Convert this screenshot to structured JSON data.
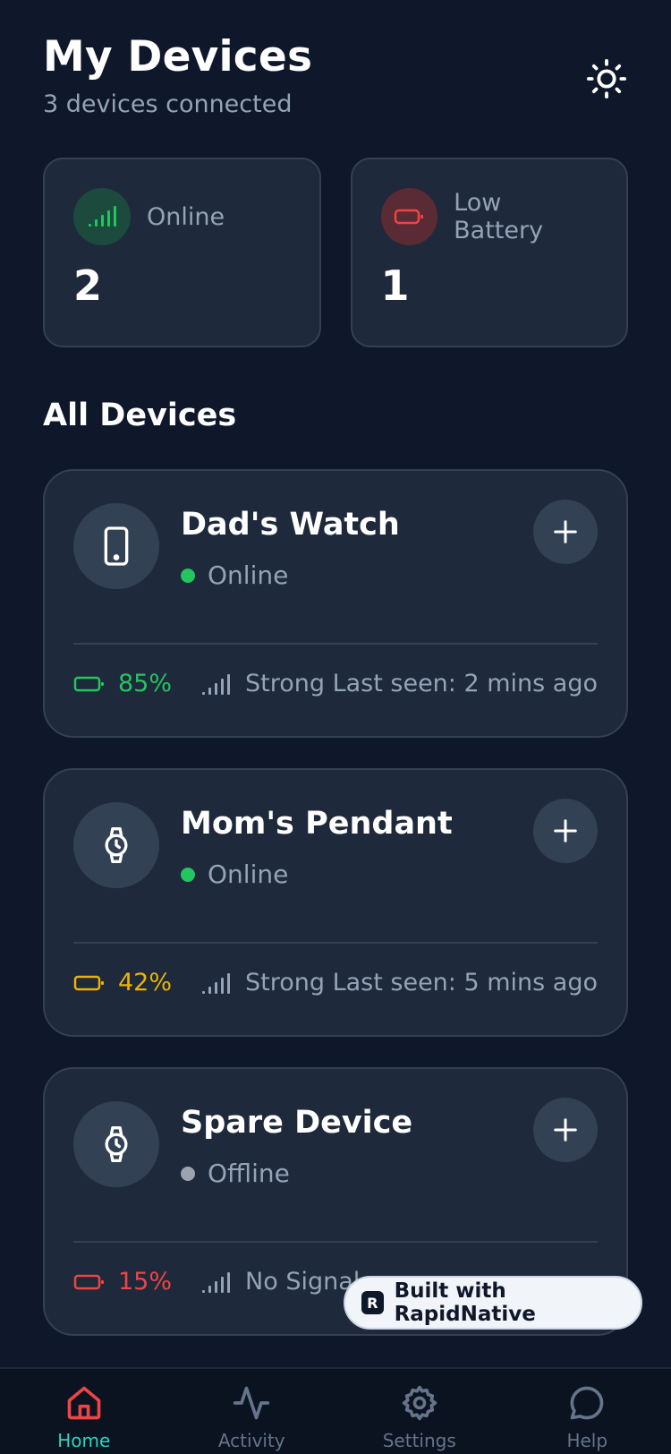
{
  "header": {
    "title": "My Devices",
    "subtitle": "3 devices connected",
    "theme_icon": "sun-icon"
  },
  "stats": {
    "online": {
      "label": "Online",
      "value": "2",
      "icon": "signal-icon",
      "color": "#22c55e"
    },
    "low_battery": {
      "label": "Low Battery",
      "value": "1",
      "icon": "battery-icon",
      "color": "#ef4444"
    }
  },
  "section": {
    "title": "All Devices"
  },
  "devices": [
    {
      "name": "Dad's Watch",
      "status": "Online",
      "status_color": "#22c55e",
      "icon": "smartphone-icon",
      "battery": "85%",
      "battery_color": "#22c55e",
      "signal": "Strong",
      "last_seen": "Last seen: 2 mins ago"
    },
    {
      "name": "Mom's Pendant",
      "status": "Online",
      "status_color": "#22c55e",
      "icon": "watch-icon",
      "battery": "42%",
      "battery_color": "#eab308",
      "signal": "Strong",
      "last_seen": "Last seen: 5 mins ago"
    },
    {
      "name": "Spare Device",
      "status": "Offline",
      "status_color": "#9ca3af",
      "icon": "watch-icon",
      "battery": "15%",
      "battery_color": "#ef4444",
      "signal": "No Signal",
      "last_seen": ""
    }
  ],
  "badge": {
    "text": "Built with RapidNative",
    "logo": "R"
  },
  "tabs": [
    {
      "label": "Home",
      "icon": "home-icon",
      "active": true
    },
    {
      "label": "Activity",
      "icon": "activity-icon",
      "active": false
    },
    {
      "label": "Settings",
      "icon": "gear-icon",
      "active": false
    },
    {
      "label": "Help",
      "icon": "chat-bubble-icon",
      "active": false
    }
  ],
  "colors": {
    "background": "#0f172a",
    "card": "#1e293b",
    "border": "#334155",
    "accent_active_tab_icon": "#ef4444",
    "accent_active_tab_label": "#2dd4bf"
  }
}
